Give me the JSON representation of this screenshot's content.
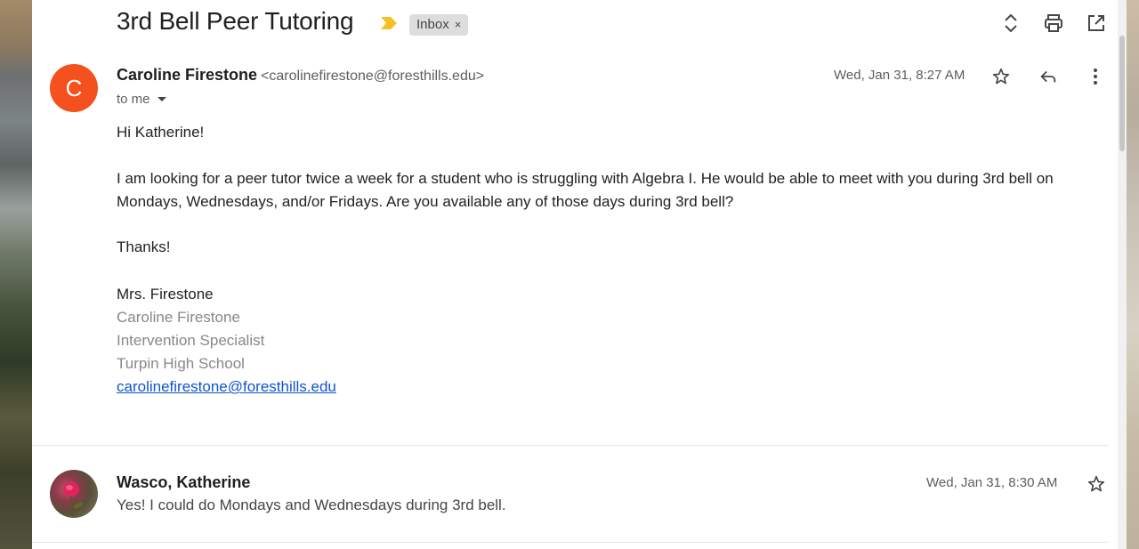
{
  "thread": {
    "subject": "3rd Bell Peer Tutoring",
    "label": "Inbox",
    "label_remove": "×"
  },
  "toolbar": {
    "icons": [
      "expand-collapse-icon",
      "print-icon",
      "open-in-new-window-icon"
    ]
  },
  "message1": {
    "avatar_letter": "C",
    "avatar_color": "#f4511e",
    "sender_name": "Caroline Firestone",
    "sender_email": "<carolinefirestone@foresthills.edu>",
    "recipient": "to me",
    "timestamp": "Wed, Jan 31, 8:27 AM",
    "greeting": "Hi Katherine!",
    "paragraph1_line1": "I am looking for a peer tutor twice a week for a student who is struggling with Algebra I. He would be able to meet with you during 3rd bell on",
    "paragraph1_line2": "Mondays, Wednesdays, and/or Fridays. Are you available any of those days during 3rd bell?",
    "closing": "Thanks!",
    "signature": {
      "salutation_name": "Mrs. Firestone",
      "full_name": "Caroline Firestone",
      "title": "Intervention Specialist",
      "school": "Turpin High School",
      "email_link": "carolinefirestone@foresthills.edu"
    }
  },
  "message2": {
    "sender_name": "Wasco, Katherine",
    "timestamp": "Wed, Jan 31, 8:30 AM",
    "snippet": "Yes! I could do Mondays and Wednesdays during 3rd bell."
  },
  "colors": {
    "link": "#1155cc",
    "importance_marker": "#f6bf26"
  }
}
